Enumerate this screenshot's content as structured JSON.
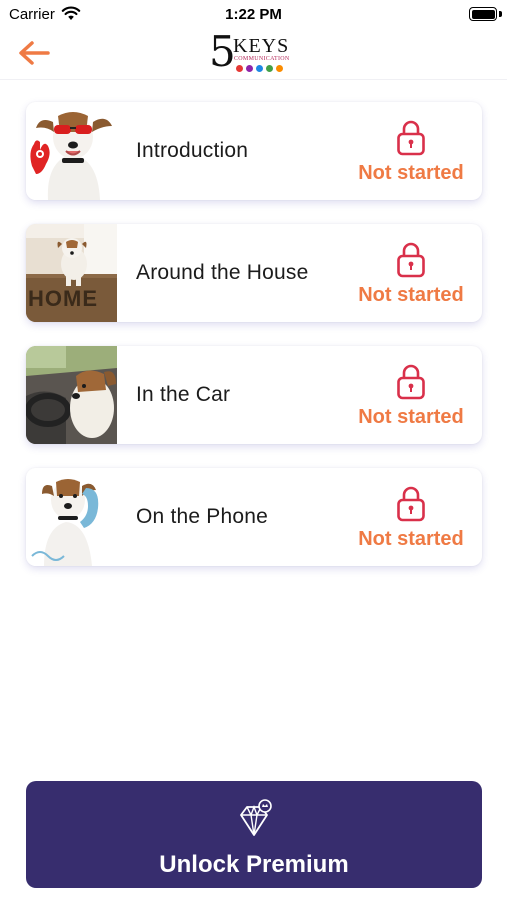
{
  "status_bar": {
    "carrier": "Carrier",
    "time": "1:22 PM"
  },
  "header": {
    "back_icon": "arrow-left-icon",
    "logo": {
      "number": "5",
      "word": "KEYS",
      "tagline": "COMMUNICATION"
    }
  },
  "lessons": [
    {
      "title": "Introduction",
      "status": "Not started",
      "locked": true,
      "icon": "lock-icon"
    },
    {
      "title": "Around the House",
      "status": "Not started",
      "locked": true,
      "icon": "lock-icon"
    },
    {
      "title": "In the Car",
      "status": "Not started",
      "locked": true,
      "icon": "lock-icon"
    },
    {
      "title": "On the Phone",
      "status": "Not started",
      "locked": true,
      "icon": "lock-icon"
    }
  ],
  "premium": {
    "label": "Unlock Premium",
    "icon": "diamond-icon"
  },
  "colors": {
    "accent_orange": "#ef7a44",
    "lock_red": "#d9304a",
    "premium_bg": "#372d6e",
    "logo_dots": [
      "#e53935",
      "#8e24aa",
      "#1e88e5",
      "#43a047",
      "#fb8c00"
    ]
  }
}
